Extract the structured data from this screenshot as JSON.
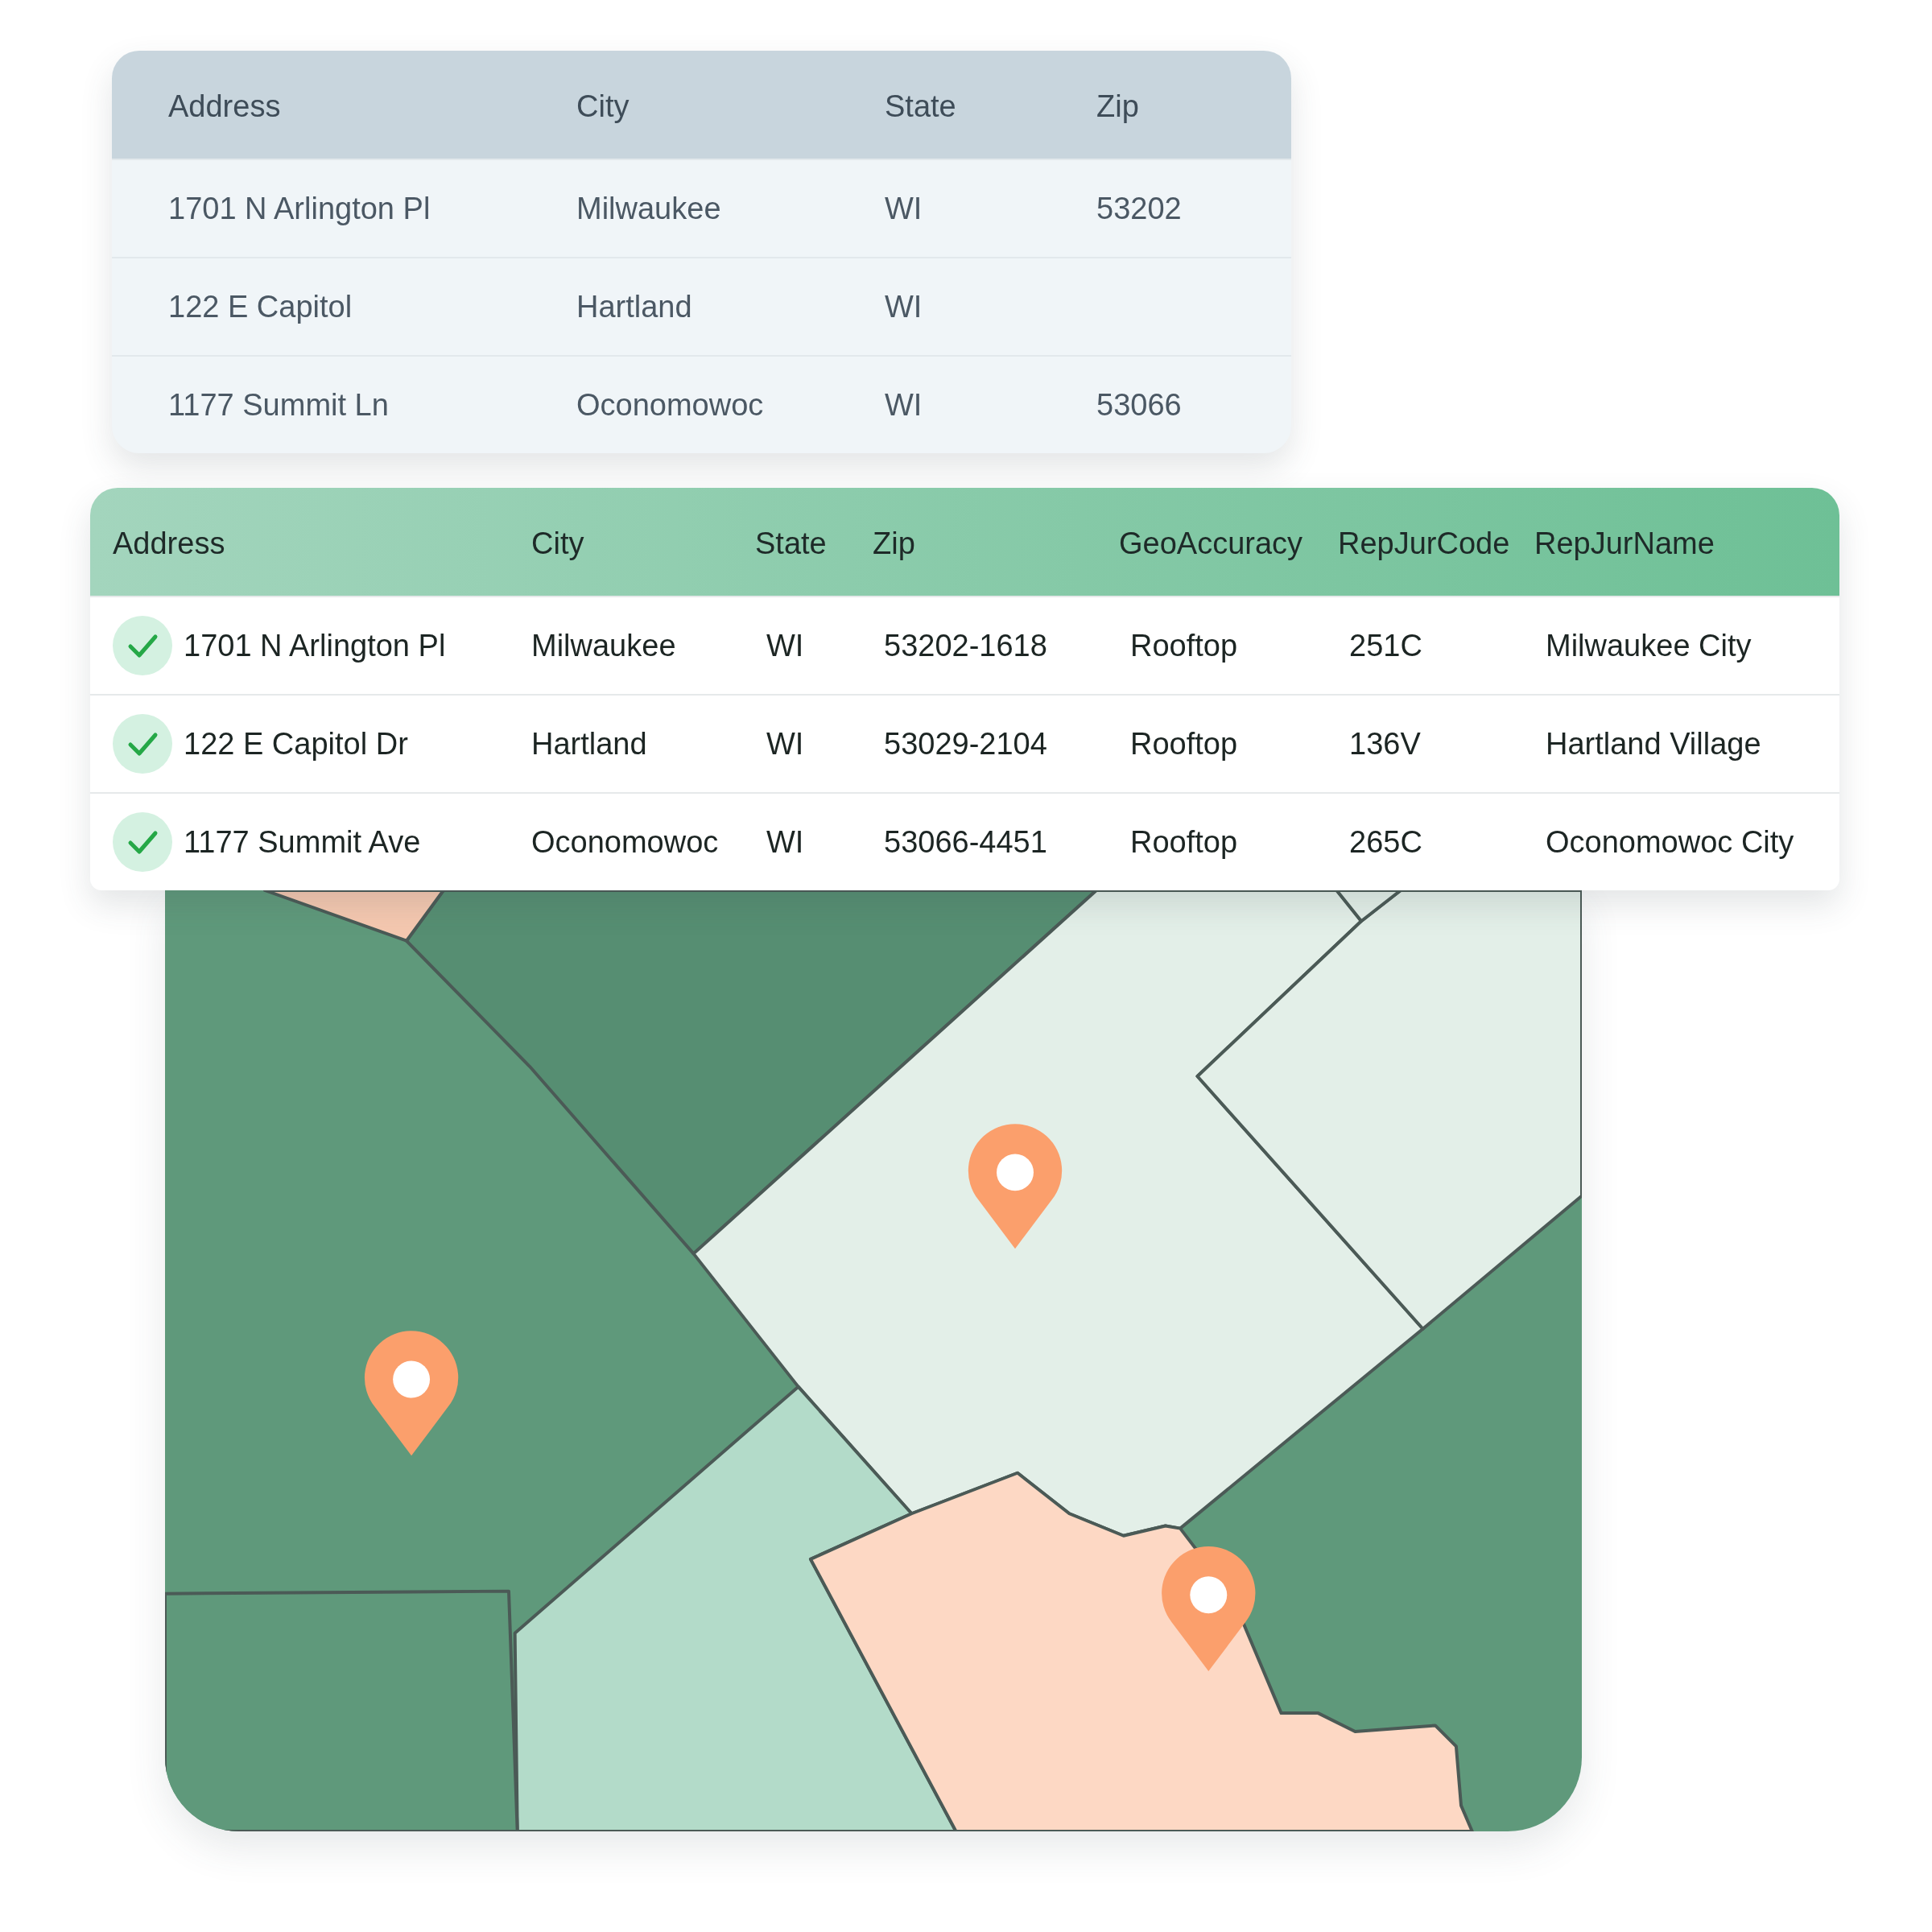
{
  "source_table": {
    "columns": [
      "Address",
      "City",
      "State",
      "Zip"
    ],
    "rows": [
      {
        "address": "1701 N Arlington Pl",
        "city": "Milwaukee",
        "state": "WI",
        "zip": "53202"
      },
      {
        "address": "122 E Capitol",
        "city": "Hartland",
        "state": "WI"
      },
      {
        "address": "1177 Summit Ln",
        "city": "Oconomowoc",
        "state": "WI",
        "zip": "53066"
      }
    ]
  },
  "result_table": {
    "columns": [
      "Address",
      "City",
      "State",
      "Zip",
      "GeoAccuracy",
      "RepJurCode",
      "RepJurName"
    ],
    "rows": [
      {
        "verified": true,
        "address": "1701 N Arlington Pl",
        "city": "Milwaukee",
        "state": "WI",
        "zip": "53202-1618",
        "geo_accuracy": "Rooftop",
        "rep_jur_code": "251C",
        "rep_jur_name": "Milwaukee City"
      },
      {
        "verified": true,
        "address": "122 E Capitol Dr",
        "city": "Hartland",
        "state": "WI",
        "zip": "53029-2104",
        "geo_accuracy": "Rooftop",
        "rep_jur_code": "136V",
        "rep_jur_name": "Hartland Village"
      },
      {
        "verified": true,
        "address": "1177 Summit Ave",
        "city": "Oconomowoc",
        "state": "WI",
        "zip": "53066-4451",
        "geo_accuracy": "Rooftop",
        "rep_jur_code": "265C",
        "rep_jur_name": "Oconomowoc City"
      }
    ]
  }
}
